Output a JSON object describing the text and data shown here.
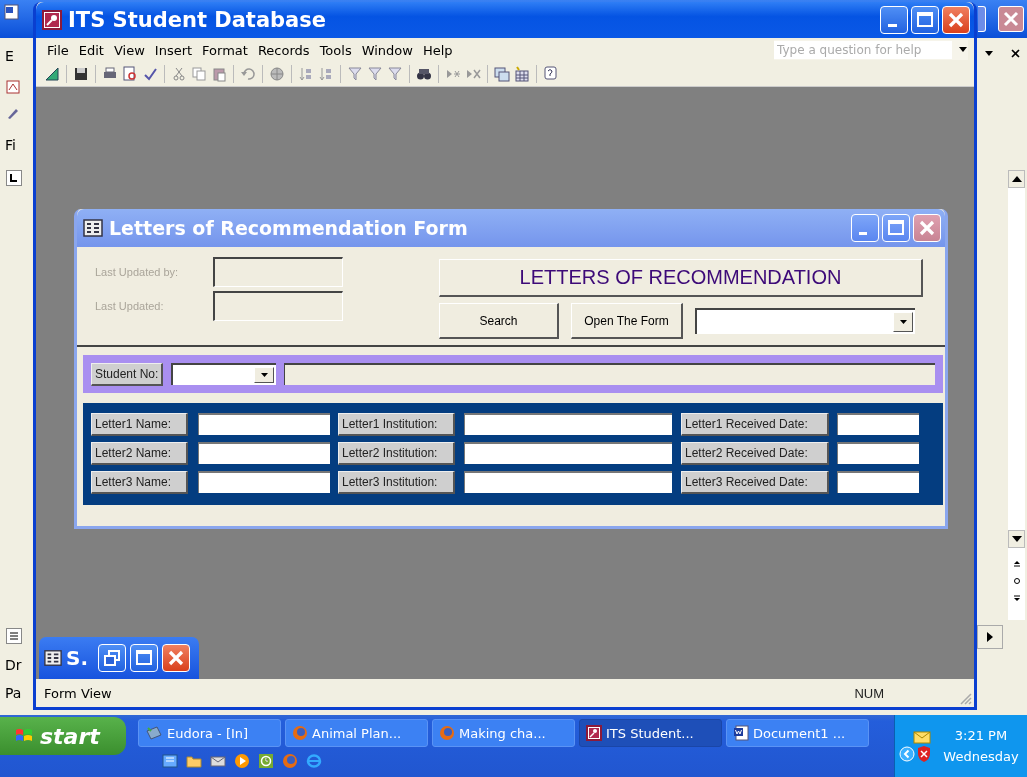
{
  "background_window": {
    "fragments": [
      "E",
      "Fi",
      "Dr",
      "Pa"
    ]
  },
  "window": {
    "title": "ITS Student Database",
    "menus": [
      "File",
      "Edit",
      "View",
      "Insert",
      "Format",
      "Records",
      "Tools",
      "Window",
      "Help"
    ],
    "help_placeholder": "Type a question for help"
  },
  "form": {
    "title": "Letters of Recommendation Form",
    "info_labels": [
      "Last Updated by:",
      "Last Updated:"
    ],
    "heading": "LETTERS OF RECOMMENDATION",
    "buttons": [
      "Search",
      "Open The Form"
    ],
    "student_no_label": "Student No:",
    "letters": [
      {
        "name_label": "Letter1 Name:",
        "institution_label": "Letter1 Institution:",
        "date_label": "Letter1 Received Date:"
      },
      {
        "name_label": "Letter2 Name:",
        "institution_label": "Letter2 Institution:",
        "date_label": "Letter2 Received Date:"
      },
      {
        "name_label": "Letter3 Name:",
        "institution_label": "Letter3 Institution:",
        "date_label": "Letter3 Received Date:"
      }
    ]
  },
  "minimized_window": {
    "title": "S."
  },
  "status_bar": {
    "view": "Form View",
    "indicator": "NUM"
  },
  "taskbar": {
    "start": "start",
    "tasks": [
      {
        "label": "Eudora - [In]",
        "kind": "mail",
        "selected": false
      },
      {
        "label": "Animal Plan...",
        "kind": "browser",
        "selected": false
      },
      {
        "label": "Making cha...",
        "kind": "browser",
        "selected": false
      },
      {
        "label": "ITS Student...",
        "kind": "database",
        "selected": true
      },
      {
        "label": "Document1 ...",
        "kind": "document",
        "selected": false
      }
    ],
    "clock": "3:21 PM",
    "day": "Wednesday"
  }
}
